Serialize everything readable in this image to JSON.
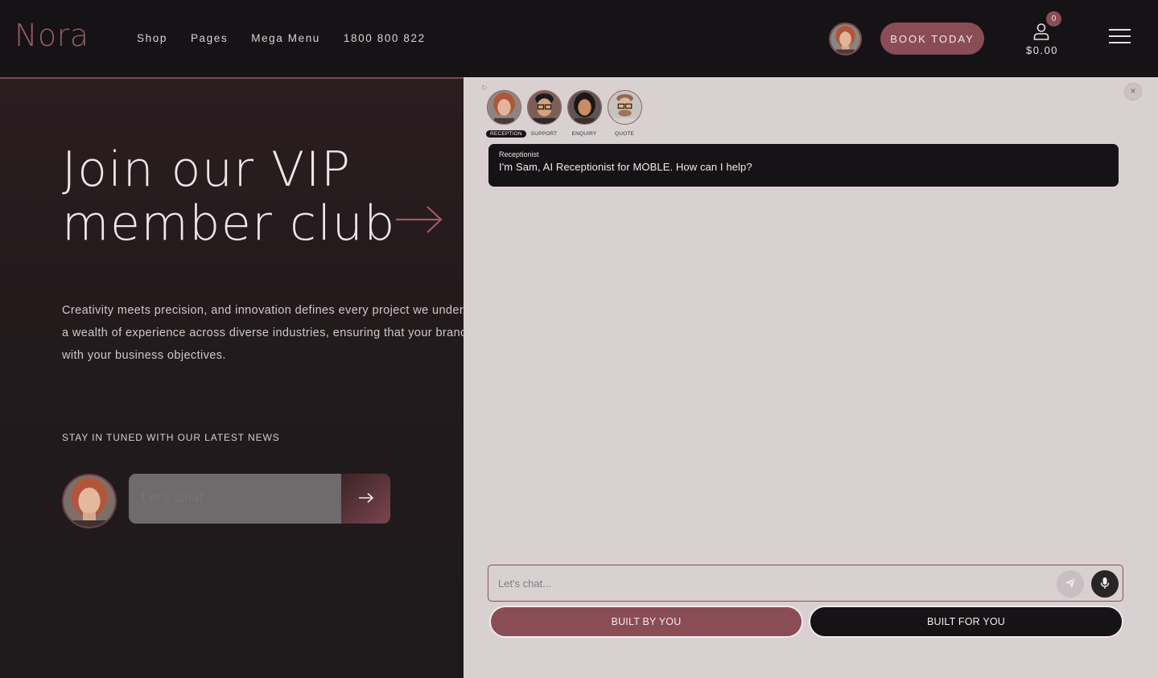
{
  "header": {
    "logo": "Nora",
    "nav": [
      "Shop",
      "Pages",
      "Mega Menu",
      "1800 800 822"
    ],
    "book_label": "BOOK TODAY",
    "cart_count": "0",
    "cart_total": "$0.00"
  },
  "hero": {
    "title_line1": "Join our VIP",
    "title_line2": "member club",
    "desc_line1": "Creativity meets precision, and innovation defines every project we under",
    "desc_line2": "a wealth of experience across diverse industries, ensuring that your branc",
    "desc_line3": "with your business objectives.",
    "stay_label": "STAY IN TUNED WITH OUR LATEST NEWS",
    "chat_placeholder": "Let's Chat......"
  },
  "panel": {
    "agents": [
      {
        "label": "RECEPTION",
        "active": true
      },
      {
        "label": "SUPPORT",
        "active": false
      },
      {
        "label": "ENQUIRY",
        "active": false
      },
      {
        "label": "QUOTE",
        "active": false
      }
    ],
    "close_glyph": "×",
    "message": {
      "sender": "Receptionist",
      "text": "I'm Sam, AI Receptionist for MOBLE. How can I help?"
    },
    "input_placeholder": "Let's chat...",
    "built_by": "BUILT BY YOU",
    "built_for": "BUILT FOR YOU"
  },
  "colors": {
    "accent": "#8a4d55",
    "panel_bg": "#d9d0d2",
    "dark": "#151315"
  }
}
